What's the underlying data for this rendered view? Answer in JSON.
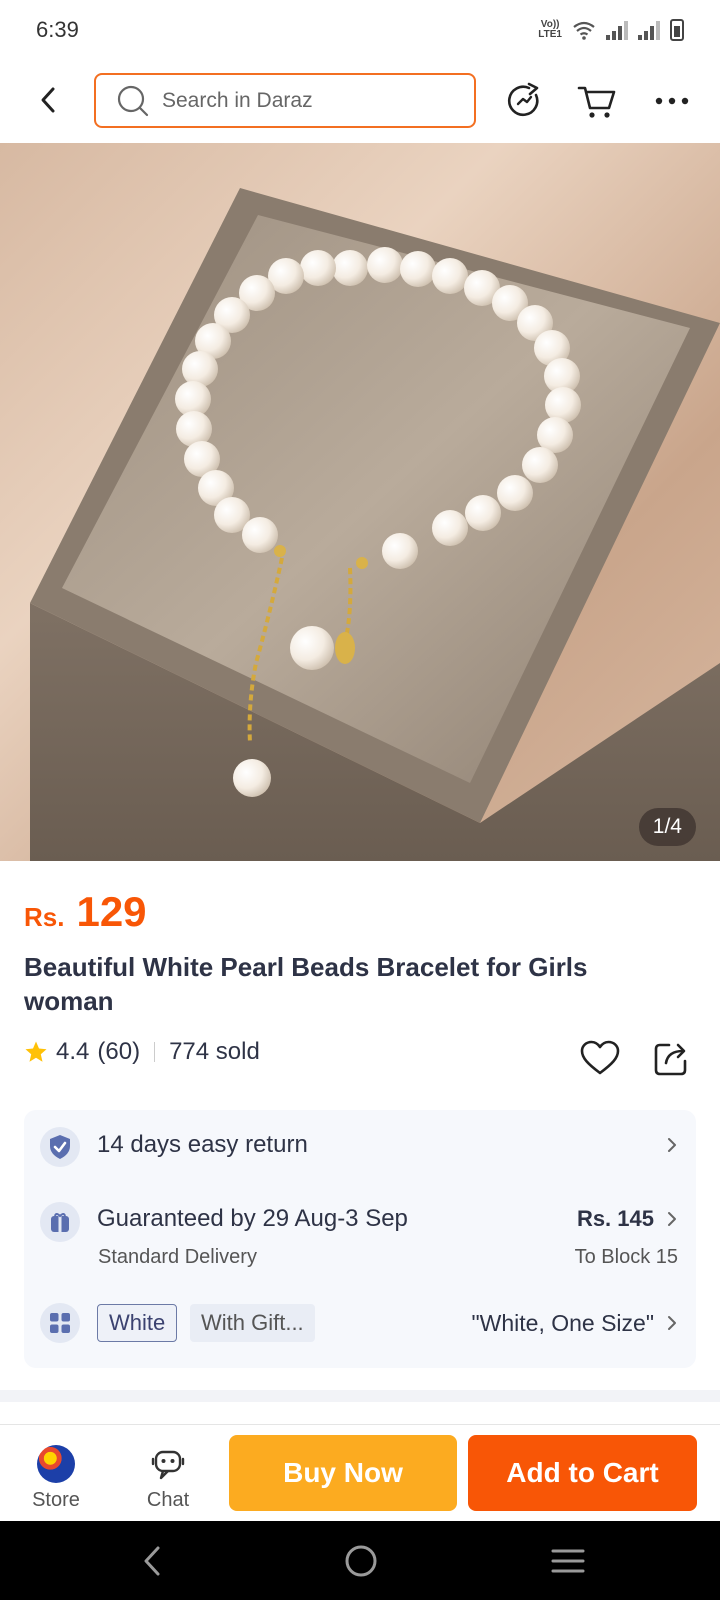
{
  "status_bar": {
    "time": "6:39",
    "volte": "Vo)) LTE1"
  },
  "search": {
    "placeholder": "Search in Daraz"
  },
  "gallery": {
    "counter": "1/4"
  },
  "product": {
    "currency": "Rs.",
    "price": "129",
    "title": "Beautiful  White Pearl Beads Bracelet for Girls woman",
    "rating": "4.4",
    "reviews": "(60)",
    "sold": "774 sold"
  },
  "info": {
    "return": {
      "text": "14 days easy return",
      "icon": "shield-check-icon"
    },
    "delivery": {
      "text": "Guaranteed by 29 Aug-3 Sep",
      "sub": "Standard Delivery",
      "price": "Rs. 145",
      "location": "To Block 15",
      "icon": "gift-box-icon"
    },
    "variant": {
      "chips": [
        "White",
        "With Gift..."
      ],
      "selected": "\"White, One Size\"",
      "icon": "grid-icon"
    }
  },
  "bottom_bar": {
    "store_label": "Store",
    "chat_label": "Chat",
    "buy_now": "Buy Now",
    "add_to_cart": "Add to Cart"
  },
  "colors": {
    "accent": "#f85606",
    "buy_now": "#fcab20",
    "search_border": "#f36f21"
  }
}
